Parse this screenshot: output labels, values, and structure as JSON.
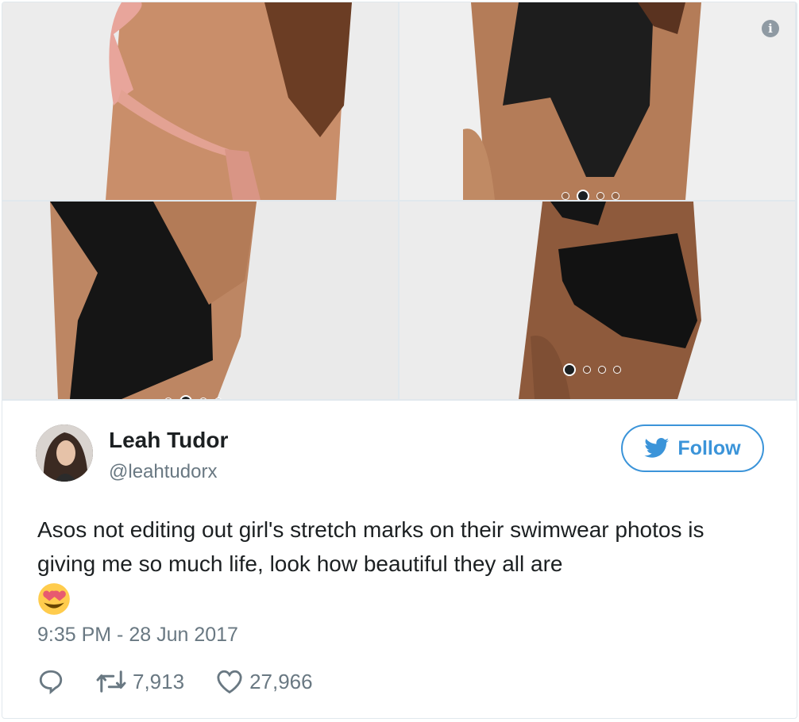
{
  "gallery": {
    "images": [
      {
        "alt": "swimwear-photo-1"
      },
      {
        "alt": "swimwear-photo-2"
      },
      {
        "alt": "swimwear-photo-3"
      },
      {
        "alt": "swimwear-photo-4"
      }
    ],
    "info_icon": "info-icon",
    "carousel_dot_count": 4
  },
  "tweet": {
    "author_name": "Leah Tudor",
    "author_handle": "@leahtudorx",
    "follow_label": "Follow",
    "text": "Asos not editing out girl's stretch marks on their swimwear photos is giving me so much life, look how beautiful they all are",
    "emoji": "heart-eyes-emoji",
    "timestamp": "9:35 PM - 28 Jun 2017",
    "retweets": "7,913",
    "likes": "27,966"
  },
  "colors": {
    "accent": "#3b94d9",
    "muted": "#697882",
    "text": "#1c2022",
    "border": "#e1e8ed"
  }
}
